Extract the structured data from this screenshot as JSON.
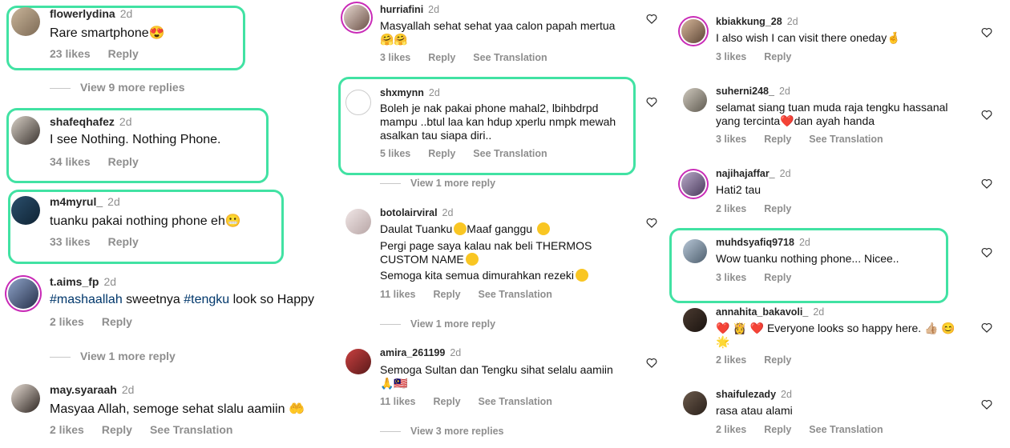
{
  "col1": {
    "c1": {
      "user": "flowerlydina",
      "age": "2d",
      "text": "Rare smartphone",
      "emoji": "😍",
      "likes": "23 likes",
      "reply": "Reply"
    },
    "more1": "View 9 more replies",
    "c2": {
      "user": "shafeqhafez",
      "age": "2d",
      "text": "I see Nothing. Nothing Phone.",
      "likes": "34 likes",
      "reply": "Reply"
    },
    "c3": {
      "user": "m4myrul_",
      "age": "2d",
      "text": "tuanku pakai nothing phone eh",
      "emoji": "😬",
      "likes": "33 likes",
      "reply": "Reply"
    },
    "c4": {
      "user": "t.aims_fp",
      "age": "2d",
      "tag1": "#mashaallah",
      "mid": " sweetnya ",
      "tag2": "#tengku",
      "end": " look so Happy",
      "likes": "2 likes",
      "reply": "Reply"
    },
    "more2": "View 1 more reply",
    "c5": {
      "user": "may.syaraah",
      "age": "2d",
      "text": "Masyaa Allah, semoge sehat slalu aamiin",
      "emoji": "🤲",
      "likes": "2 likes",
      "reply": "Reply",
      "translate": "See Translation"
    }
  },
  "col2": {
    "c1": {
      "user": "hurriafini",
      "age": "2d",
      "text": "Masyallah sehat sehat yaa calon papah mertua",
      "emoji": "🤗🤗",
      "likes": "3 likes",
      "reply": "Reply",
      "translate": "See Translation"
    },
    "c2": {
      "user": "shxmynn",
      "age": "2d",
      "text": "Boleh je nak pakai phone mahal2, lbihbdrpd mampu ..btul laa kan hdup xperlu nmpk mewah asalkan tau siapa diri..",
      "likes": "5 likes",
      "reply": "Reply",
      "translate": "See Translation"
    },
    "more1": "View 1 more reply",
    "c3": {
      "user": "botolairviral",
      "age": "2d",
      "line1": "Daulat Tuanku",
      "line1b": "Maaf ganggu",
      "line2": "Pergi page saya kalau nak beli THERMOS CUSTOM NAME",
      "line3": "Semoga kita semua dimurahkan rezeki",
      "likes": "11 likes",
      "reply": "Reply",
      "translate": "See Translation"
    },
    "more2": "View 1 more reply",
    "c4": {
      "user": "amira_261199",
      "age": "2d",
      "text": "Semoga Sultan dan Tengku sihat selalu aamiin",
      "emoji": "🙏🇲🇾",
      "likes": "11 likes",
      "reply": "Reply",
      "translate": "See Translation"
    },
    "more3": "View 3 more replies"
  },
  "col3": {
    "c1": {
      "user": "kbiakkung_28",
      "age": "2d",
      "text": "I also wish I can visit there oneday",
      "emoji": "🤞",
      "likes": "3 likes",
      "reply": "Reply"
    },
    "c2": {
      "user": "suherni248_",
      "age": "2d",
      "text": "selamat siang tuan muda raja tengku hassanal yang tercinta",
      "emoji": "❤️",
      "text2": "dan ayah handa",
      "likes": "3 likes",
      "reply": "Reply",
      "translate": "See Translation"
    },
    "c3": {
      "user": "najihajaffar_",
      "age": "2d",
      "text": "Hati2 tau",
      "likes": "2 likes",
      "reply": "Reply"
    },
    "c4": {
      "user": "muhdsyafiq9718",
      "age": "2d",
      "text": "Wow tuanku nothing phone... Nicee..",
      "likes": "3 likes",
      "reply": "Reply"
    },
    "c5": {
      "user": "annahita_bakavoli_",
      "age": "2d",
      "emoji": "❤️ 👸 ❤️",
      "text": "Everyone looks so happy here.",
      "emoji2": "👍🏼 😊 🌟",
      "likes": "2 likes",
      "reply": "Reply"
    },
    "c6": {
      "user": "shaifulezady",
      "age": "2d",
      "text": "rasa atau alami",
      "likes": "2 likes",
      "reply": "Reply",
      "translate": "See Translation"
    }
  }
}
